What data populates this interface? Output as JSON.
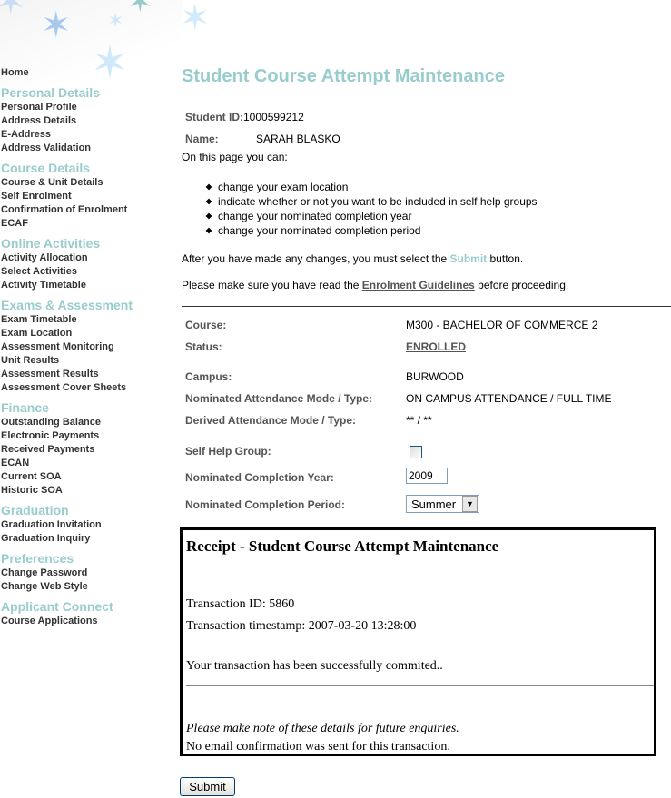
{
  "sidebar": {
    "home": "Home",
    "sections": [
      {
        "title": "Personal Details",
        "items": [
          "Personal Profile",
          "Address Details",
          "E-Address",
          "Address Validation"
        ]
      },
      {
        "title": "Course Details",
        "items": [
          "Course & Unit Details",
          "Self Enrolment",
          "Confirmation of Enrolment",
          "ECAF"
        ]
      },
      {
        "title": "Online Activities",
        "items": [
          "Activity Allocation",
          "Select Activities",
          "Activity Timetable"
        ]
      },
      {
        "title": "Exams & Assessment",
        "items": [
          "Exam Timetable",
          "Exam Location",
          "Assessment Monitoring",
          "Unit Results",
          "Assessment Results",
          "Assessment Cover Sheets"
        ]
      },
      {
        "title": "Finance",
        "items": [
          "Outstanding Balance",
          "Electronic Payments",
          "Received Payments",
          "ECAN",
          "Current SOA",
          "Historic SOA"
        ]
      },
      {
        "title": "Graduation",
        "items": [
          "Graduation Invitation",
          "Graduation Inquiry"
        ]
      },
      {
        "title": "Preferences",
        "items": [
          "Change Password",
          "Change Web Style"
        ]
      },
      {
        "title": "Applicant Connect",
        "items": [
          "Course Applications"
        ]
      }
    ]
  },
  "page": {
    "title": "Student Course Attempt Maintenance",
    "student_id_label": "Student ID:",
    "student_id": "1000599212",
    "name_label": "Name:",
    "name": "SARAH BLASKO",
    "intro": "On this page you can:",
    "bullets": [
      "change your exam location",
      "indicate whether or not you want to be included in self help groups",
      "change your nominated completion year",
      "change your nominated completion period"
    ],
    "after_pre": "After you have made any changes, you must select the ",
    "after_link": "Submit",
    "after_post": " button.",
    "guide_pre": "Please make sure you have read the ",
    "guide_link": "Enrolment Guidelines",
    "guide_post": " before proceeding."
  },
  "form": {
    "course_label": "Course:",
    "course": "M300 - BACHELOR OF COMMERCE 2",
    "status_label": "Status:",
    "status": "ENROLLED",
    "campus_label": "Campus:",
    "campus": "BURWOOD",
    "nom_mode_label": "Nominated Attendance Mode / Type:",
    "nom_mode": "ON CAMPUS ATTENDANCE / FULL TIME",
    "der_mode_label": "Derived Attendance Mode / Type:",
    "der_mode": "** / **",
    "shg_label": "Self Help Group:",
    "shg_checked": false,
    "year_label": "Nominated Completion Year:",
    "year": "2009",
    "period_label": "Nominated Completion Period:",
    "period": "Summer"
  },
  "receipt": {
    "title": "Receipt - Student Course Attempt Maintenance",
    "txn_id": "Transaction ID: 5860",
    "txn_ts": "Transaction timestamp: 2007-03-20 13:28:00",
    "msg": "Your transaction has been successfully commited..",
    "note": "Please make note of these details for future enquiries.",
    "email": "No email confirmation was sent for this transaction."
  },
  "submit_label": "Submit",
  "colors": {
    "accent": "#99cccc",
    "label": "#555555"
  }
}
